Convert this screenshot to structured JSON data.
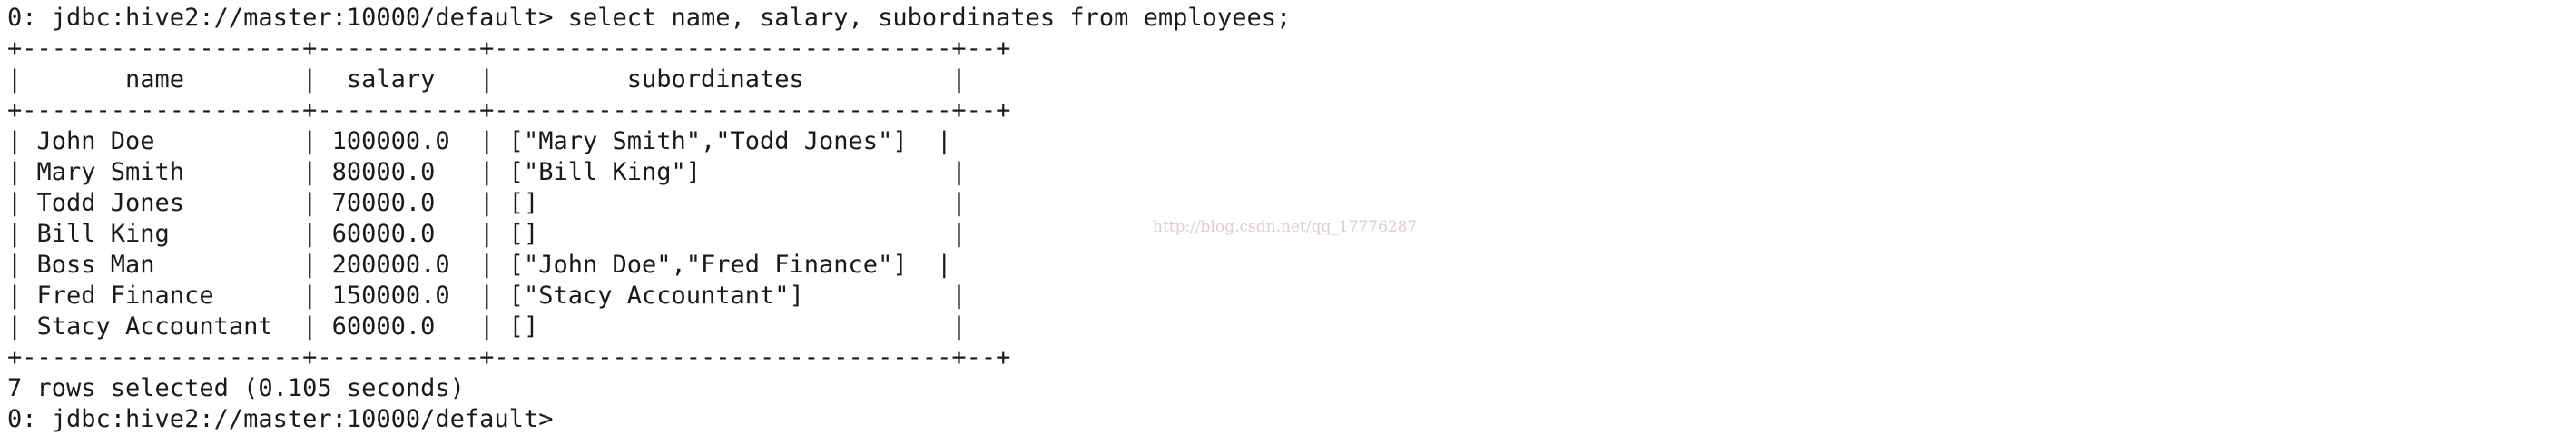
{
  "terminal": {
    "prompt_line": "0: jdbc:hive2://master:10000/default> select name, salary, subordinates from employees;",
    "border_top": "+-------------------+-----------+-------------------------------+--+",
    "header_row": "|       name        |  salary   |         subordinates          |",
    "border_mid": "+-------------------+-----------+-------------------------------+--+",
    "rows": [
      "| John Doe          | 100000.0  | [\"Mary Smith\",\"Todd Jones\"]  |",
      "| Mary Smith        | 80000.0   | [\"Bill King\"]                 |",
      "| Todd Jones        | 70000.0   | []                            |",
      "| Bill King         | 60000.0   | []                            |",
      "| Boss Man          | 200000.0  | [\"John Doe\",\"Fred Finance\"]  |",
      "| Fred Finance      | 150000.0  | [\"Stacy Accountant\"]          |",
      "| Stacy Accountant  | 60000.0   | []                            |"
    ],
    "border_bottom": "+-------------------+-----------+-------------------------------+--+",
    "summary": "7 rows selected (0.105 seconds)",
    "next_prompt": "0: jdbc:hive2://master:10000/default>"
  },
  "watermark": "http://blog.csdn.net/qq_17776287"
}
